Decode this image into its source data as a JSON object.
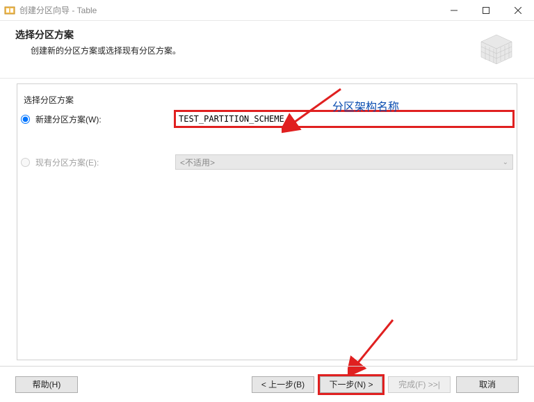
{
  "window": {
    "title": "创建分区向导 - Table"
  },
  "header": {
    "title": "选择分区方案",
    "subtitle": "创建新的分区方案或选择现有分区方案。"
  },
  "group": {
    "legend": "选择分区方案",
    "new_scheme_label": "新建分区方案(W):",
    "new_scheme_value": "TEST_PARTITION_SCHEME",
    "existing_scheme_label": "现有分区方案(E):",
    "existing_scheme_value": "<不适用>"
  },
  "annotation": {
    "label": "分区架构名称"
  },
  "footer": {
    "help": "帮助(H)",
    "prev": "< 上一步(B)",
    "next": "下一步(N) >",
    "finish": "完成(F) >>|",
    "cancel": "取消"
  }
}
